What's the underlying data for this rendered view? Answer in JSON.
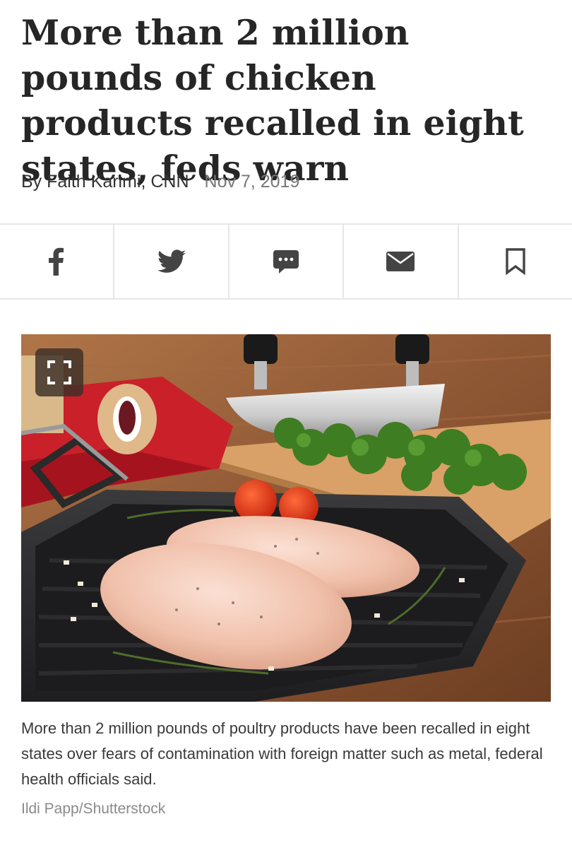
{
  "article": {
    "headline": "More than 2 million pounds of chicken products recalled in eight states, feds warn",
    "byline": "By Faith Karimi, CNN",
    "date": "Nov 7, 2019"
  },
  "share_bar": {
    "buttons": [
      {
        "icon": "facebook-icon"
      },
      {
        "icon": "twitter-icon"
      },
      {
        "icon": "comment-icon"
      },
      {
        "icon": "email-icon"
      },
      {
        "icon": "bookmark-icon"
      }
    ],
    "icon_color": "#444444"
  },
  "photo": {
    "expand_icon": "expand-icon",
    "caption": "More than 2 million pounds of poultry products have been recalled in eight states over fears of contamination with foreign matter such as metal, federal health officials said.",
    "credit": "Ildi Papp/Shutterstock"
  }
}
